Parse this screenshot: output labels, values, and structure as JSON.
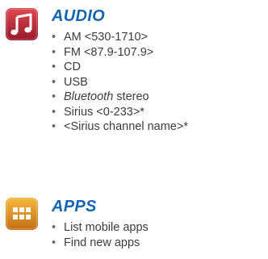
{
  "audio": {
    "title": "AUDIO",
    "icon": "music-note-icon",
    "icon_colors": {
      "top": "#d9444b",
      "bottom": "#9c1a24"
    },
    "items": [
      {
        "label": "AM <530-1710>"
      },
      {
        "label": "FM <87.9-107.9>"
      },
      {
        "label": "CD"
      },
      {
        "label": "USB"
      },
      {
        "italic": "Bluetooth",
        "rest": " stereo"
      },
      {
        "label": "Sirius <0-233>*"
      },
      {
        "label": "<Sirius channel name>*"
      }
    ]
  },
  "apps": {
    "title": "APPS",
    "icon": "apps-grid-icon",
    "icon_colors": {
      "top": "#f2b33a",
      "bottom": "#c9761a"
    },
    "items": [
      {
        "label": "List mobile apps"
      },
      {
        "label": "Find new apps"
      }
    ]
  },
  "bullet": "•",
  "accent_color": "#1565b0"
}
